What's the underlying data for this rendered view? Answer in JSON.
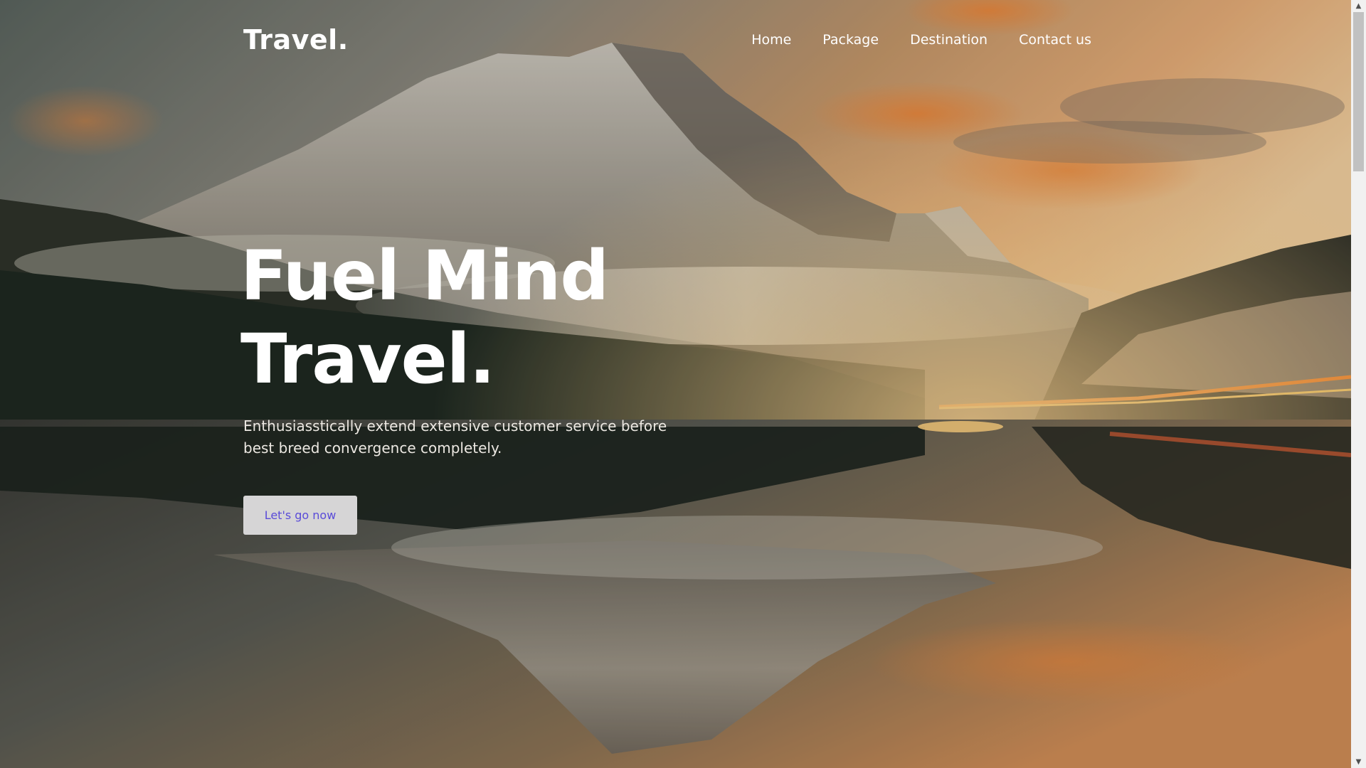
{
  "header": {
    "logo": "Travel."
  },
  "nav": {
    "items": [
      {
        "label": "Home"
      },
      {
        "label": "Package"
      },
      {
        "label": "Destination"
      },
      {
        "label": "Contact us"
      }
    ]
  },
  "hero": {
    "title_line1": "Fuel Mind",
    "title_line2": "Travel.",
    "subtitle": "Enthusiasstically extend extensive customer service before best breed convergence completely.",
    "cta_label": "Let's go now",
    "background": "mountain-lake-sunset-photo"
  },
  "colors": {
    "accent": "#5a4bd8",
    "text": "#ffffff",
    "button_bg": "#d6d5d6"
  }
}
